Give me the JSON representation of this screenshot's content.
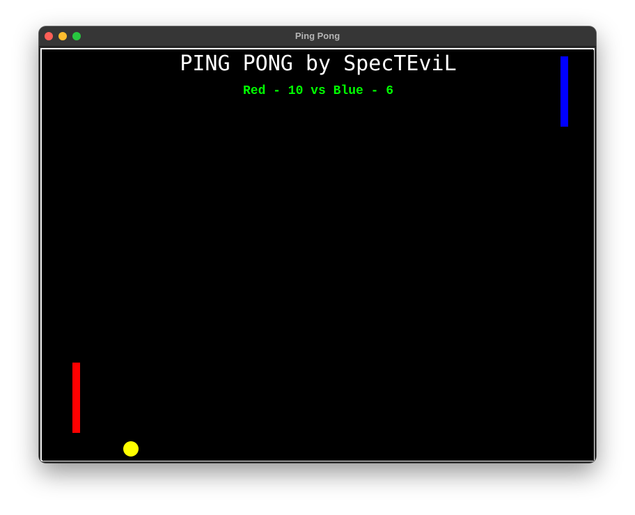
{
  "window": {
    "title": "Ping Pong"
  },
  "game": {
    "title": "PING PONG by SpecTEviL",
    "scoreboard": "Red - 10 vs Blue - 6",
    "score": {
      "red": 10,
      "blue": 6
    }
  },
  "colors": {
    "background": "#000000",
    "title_text": "#ffffff",
    "score_text": "#00ff00",
    "red_paddle": "#ff0000",
    "blue_paddle": "#0000ff",
    "ball": "#ffff00"
  }
}
